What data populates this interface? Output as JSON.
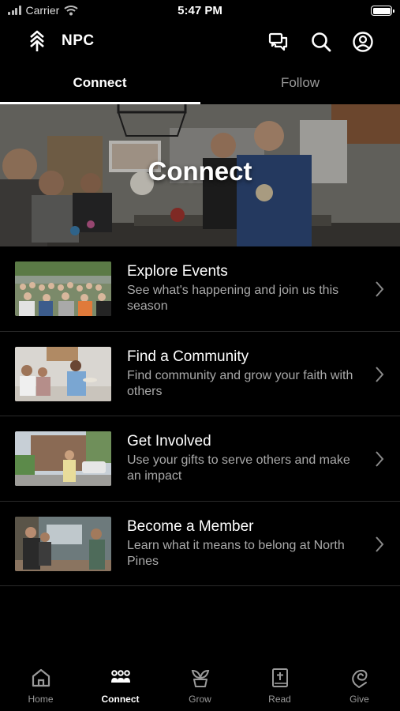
{
  "status_bar": {
    "carrier": "Carrier",
    "time": "5:47 PM"
  },
  "header": {
    "app_title": "NPC"
  },
  "tabs": [
    {
      "label": "Connect",
      "active": true
    },
    {
      "label": "Follow",
      "active": false
    }
  ],
  "hero": {
    "title": "Connect"
  },
  "items": [
    {
      "title": "Explore Events",
      "subtitle": "See what's happening and join us this season"
    },
    {
      "title": "Find a Community",
      "subtitle": "Find community and grow your faith with others"
    },
    {
      "title": "Get Involved",
      "subtitle": "Use your gifts to serve others and make an impact"
    },
    {
      "title": "Become a Member",
      "subtitle": "Learn what it means to belong at North Pines"
    }
  ],
  "bottom_nav": [
    {
      "label": "Home",
      "icon": "home-icon",
      "active": false
    },
    {
      "label": "Connect",
      "icon": "people-icon",
      "active": true
    },
    {
      "label": "Grow",
      "icon": "sprout-icon",
      "active": false
    },
    {
      "label": "Read",
      "icon": "bible-icon",
      "active": false
    },
    {
      "label": "Give",
      "icon": "give-icon",
      "active": false
    }
  ],
  "colors": {
    "background": "#000000",
    "text_primary": "#ffffff",
    "text_secondary": "#a9a9a9",
    "divider": "#2a2a2a"
  }
}
